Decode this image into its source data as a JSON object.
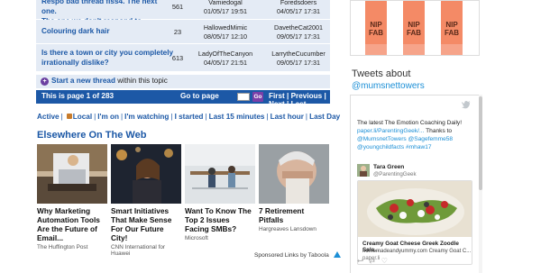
{
  "threads": [
    {
      "title_line1": "Respo bad thread fiss4. The next one.",
      "title_line2": "The one we don't respond to.",
      "replies": "561",
      "started_by": "Vamiedogal",
      "started_at": "01/05/17 19:51",
      "last_by": "Foredsdoers",
      "last_at": "04/05/17 17:31"
    },
    {
      "title_line1": "Colouring dark hair",
      "title_line2": "",
      "replies": "23",
      "started_by": "HallowedMimic",
      "started_at": "08/05/17 12:10",
      "last_by": "DavetheCat2001",
      "last_at": "09/05/17 17:31"
    },
    {
      "title_line1": "Is there a town or city you completely",
      "title_line2": "irrationally dislike?",
      "replies": "613",
      "started_by": "LadyOfTheCanyon",
      "started_at": "04/05/17 21:51",
      "last_by": "LarrytheCucumber",
      "last_at": "09/05/17 17:31"
    }
  ],
  "start_thread": {
    "bullet": "+",
    "link": "Start a new thread",
    "rest": "within this topic"
  },
  "pager": {
    "info": "This is page 1 of 283",
    "goto": "Go to page",
    "go_btn": "Go",
    "first": "First",
    "previous": "Previous",
    "next": "Next",
    "last": "Last"
  },
  "filters": {
    "active": "Active",
    "local": "Local",
    "im_on": "I'm on",
    "im_watching": "I'm watching",
    "i_started": "I started",
    "last_15": "Last 15 minutes",
    "last_hour": "Last hour",
    "last_day": "Last Day"
  },
  "elsewhere": {
    "title": "Elsewhere On The Web",
    "cards": [
      {
        "title": "Why Marketing Automation Tools Are the Future of Email...",
        "source": "The Huffington Post"
      },
      {
        "title": "Smart Initiatives That Make Sense For Our Future City!",
        "source": "CNN International for Huawei"
      },
      {
        "title": "Want To Know The Top 2 Issues Facing SMBs?",
        "source": "Microsoft"
      },
      {
        "title": "7 Retirement Pitfalls",
        "source": "Hargreaves Lansdown"
      }
    ],
    "sponsored": "Sponsored Links",
    "by": "by Taboola"
  },
  "ad": {
    "products": [
      "NIP FAB",
      "NIP FAB",
      "NIP FAB"
    ]
  },
  "twitter": {
    "title": "Tweets about",
    "handle": "@mumsnettowers",
    "tweet1": {
      "text": "The latest The Emotion Coaching Daily!",
      "link1": "paper.li/ParentingGeek/...",
      "thanks": " Thanks to",
      "mentions": "@MumsnetTowers @Sagefemme58",
      "mentions2": "@youngchildfacts",
      "hashtag": " #mhaw17"
    },
    "tweet2": {
      "name": "Tara Green",
      "username": "@ParentingGeek"
    },
    "card": {
      "title": "Creamy Goat Cheese Greek Zoodle Sala...",
      "desc": "homemadeandyummy.com Creamy Goat C...",
      "url": "paper.li"
    }
  }
}
